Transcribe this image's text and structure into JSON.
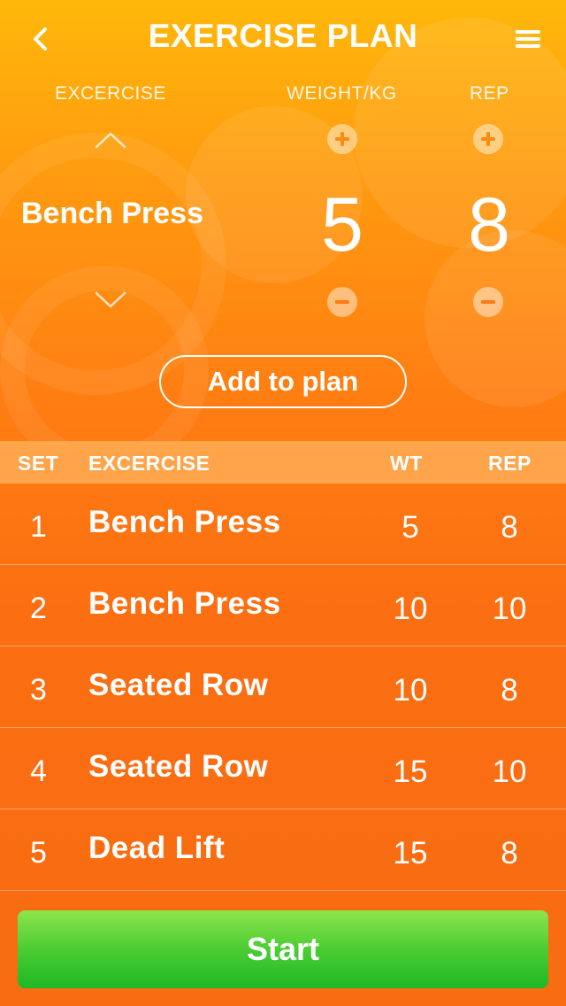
{
  "header": {
    "title": "EXERCISE PLAN"
  },
  "picker": {
    "labels": {
      "exercise": "EXCERCISE",
      "weight": "WEIGHT/KG",
      "rep": "REP"
    },
    "current_exercise": "Bench Press",
    "weight_value": "5",
    "rep_value": "8",
    "add_button_label": "Add to plan"
  },
  "table": {
    "headers": {
      "set": "SET",
      "exercise": "EXCERCISE",
      "wt": "WT",
      "rep": "REP"
    },
    "rows": [
      {
        "set": "1",
        "exercise": "Bench Press",
        "wt": "5",
        "rep": "8"
      },
      {
        "set": "2",
        "exercise": "Bench Press",
        "wt": "10",
        "rep": "10"
      },
      {
        "set": "3",
        "exercise": "Seated Row",
        "wt": "10",
        "rep": "8"
      },
      {
        "set": "4",
        "exercise": "Seated Row",
        "wt": "15",
        "rep": "10"
      },
      {
        "set": "5",
        "exercise": "Dead Lift",
        "wt": "15",
        "rep": "8"
      }
    ]
  },
  "footer": {
    "start_label": "Start"
  },
  "colors": {
    "accent_orange": "#f57412",
    "start_green": "#2cc12c"
  },
  "icons": {
    "back": "chevron-left-icon",
    "menu": "hamburger-menu-icon",
    "up": "chevron-up-icon",
    "down": "chevron-down-icon",
    "plus": "plus-circle-icon",
    "minus": "minus-circle-icon"
  }
}
